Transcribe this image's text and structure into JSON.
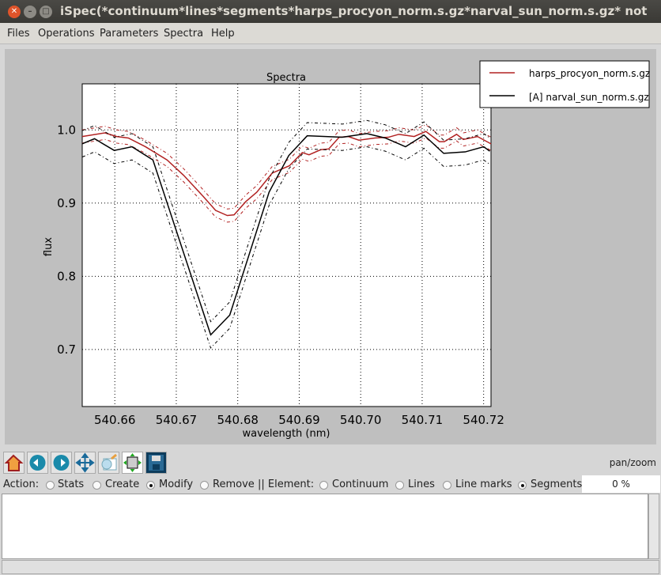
{
  "window": {
    "title": "iSpec(*continuum*lines*segments*harps_procyon_norm.s.gz*narval_sun_norm.s.gz* not saved)"
  },
  "menu": [
    "Files",
    "Operations",
    "Parameters",
    "Spectra",
    "Help"
  ],
  "toolbar": {
    "icons": [
      "home-icon",
      "back-icon",
      "forward-icon",
      "pan-icon",
      "zoom-icon",
      "subplots-icon",
      "save-icon"
    ],
    "mode": "pan/zoom"
  },
  "actions": {
    "label": "Action:",
    "options": [
      "Stats",
      "Create",
      "Modify",
      "Remove"
    ],
    "selected": "Modify",
    "separator": "|| Element:",
    "elements": [
      "Continuum",
      "Lines",
      "Line marks",
      "Segments"
    ],
    "selected_element": "Segments",
    "progress": "0 %"
  },
  "chart_data": {
    "type": "line",
    "title": "Spectra",
    "xlabel": "wavelength (nm)",
    "ylabel": "flux",
    "xlim": [
      540.6547,
      540.7212
    ],
    "ylim": [
      0.622,
      1.063
    ],
    "xticks": [
      "540.66",
      "540.67",
      "540.68",
      "540.69",
      "540.70",
      "540.71",
      "540.72"
    ],
    "yticks": [
      "0.7",
      "0.8",
      "0.9",
      "1.0"
    ],
    "grid": true,
    "legend_placement": "top-right",
    "series": [
      {
        "name": "harps_procyon_norm.s.gz",
        "color": "#b22222",
        "error": 0.009,
        "x": [
          540.6547,
          540.6584,
          540.6603,
          540.6622,
          540.665,
          540.6685,
          540.6712,
          540.6744,
          540.6764,
          540.6783,
          540.6794,
          540.6813,
          540.6831,
          540.6856,
          540.6884,
          540.6905,
          540.6916,
          540.6935,
          540.6948,
          540.6965,
          540.698,
          540.6997,
          540.7023,
          540.7045,
          540.7062,
          540.7087,
          540.7106,
          540.7128,
          540.7136,
          540.7156,
          540.7167,
          540.719,
          540.7212
        ],
        "y": [
          0.991,
          0.996,
          0.991,
          0.989,
          0.977,
          0.959,
          0.938,
          0.909,
          0.89,
          0.883,
          0.884,
          0.902,
          0.915,
          0.941,
          0.951,
          0.969,
          0.966,
          0.973,
          0.974,
          0.99,
          0.991,
          0.986,
          0.989,
          0.99,
          0.994,
          0.991,
          0.998,
          0.984,
          0.984,
          0.994,
          0.987,
          0.991,
          0.981
        ]
      },
      {
        "name": "[A] narval_sun_norm.s.gz",
        "color": "#000000",
        "error": 0.018,
        "x": [
          540.6547,
          540.6567,
          540.6599,
          540.6628,
          540.6662,
          540.6756,
          540.6787,
          540.6851,
          540.6883,
          540.6913,
          540.697,
          540.701,
          540.704,
          540.7073,
          540.7103,
          540.7135,
          540.717,
          540.72,
          540.721
        ],
        "y": [
          0.981,
          0.988,
          0.972,
          0.977,
          0.959,
          0.72,
          0.747,
          0.915,
          0.965,
          0.992,
          0.99,
          0.995,
          0.989,
          0.977,
          0.993,
          0.968,
          0.97,
          0.977,
          0.971
        ]
      }
    ]
  }
}
